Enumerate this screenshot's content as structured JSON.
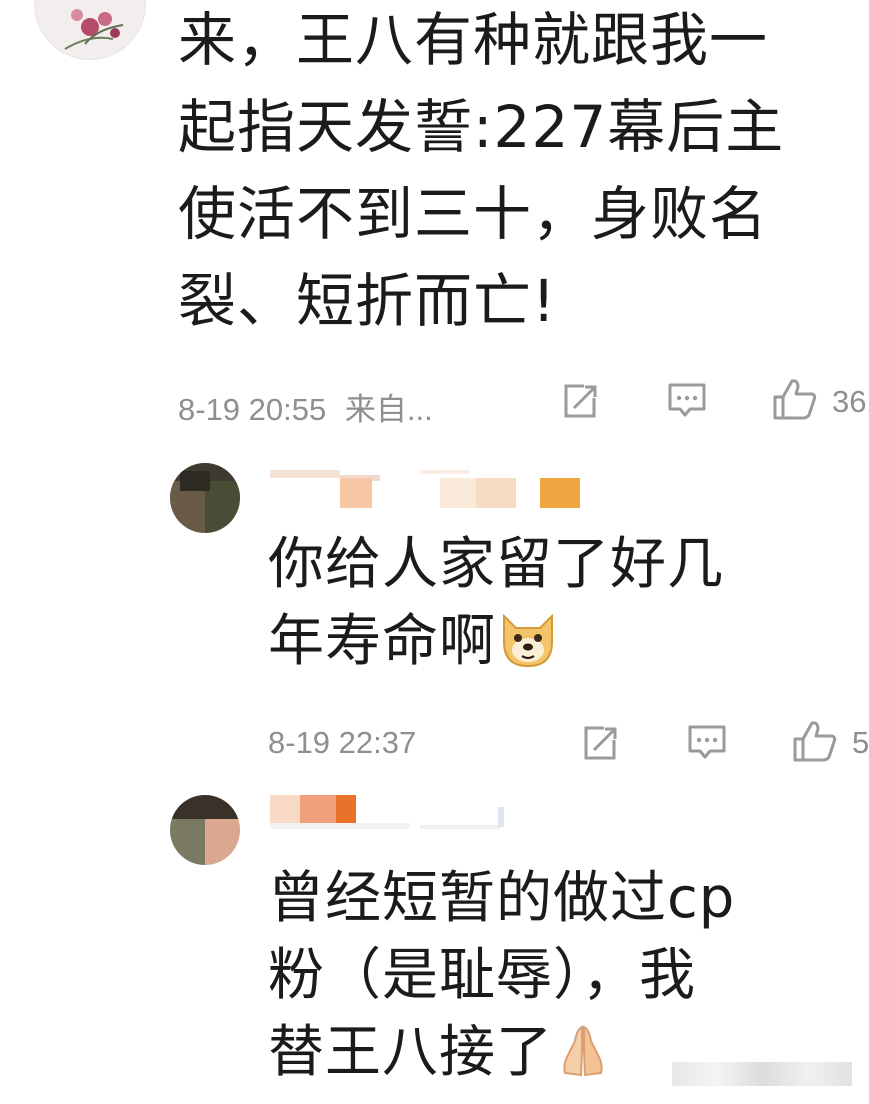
{
  "comments": [
    {
      "text_line1": "来，王八有种就跟我一",
      "text_line2": "起指天发誓:227幕后主",
      "text_line3": "使活不到三十，身败名",
      "text_line4": "裂、短折而亡!",
      "timestamp": "8-19 20:55",
      "source": "来自...",
      "like_count": "36"
    },
    {
      "text_line1": "你给人家留了好几",
      "text_line2": "年寿命啊",
      "emoji": "doge-emoji",
      "timestamp": "8-19 22:37",
      "like_count": "5"
    },
    {
      "text_line1": "曾经短暂的做过cp",
      "text_line2": "粉（是耻辱），我",
      "text_line3": "替王八接了",
      "emoji": "praying-hands-emoji"
    }
  ],
  "icons": {
    "share": "share-icon",
    "comment": "comment-icon",
    "like": "thumbs-up-icon"
  },
  "colors": {
    "text": "#1b1b1b",
    "meta": "#8f8f8f",
    "icon": "#9a9a9a",
    "background": "#ffffff"
  }
}
